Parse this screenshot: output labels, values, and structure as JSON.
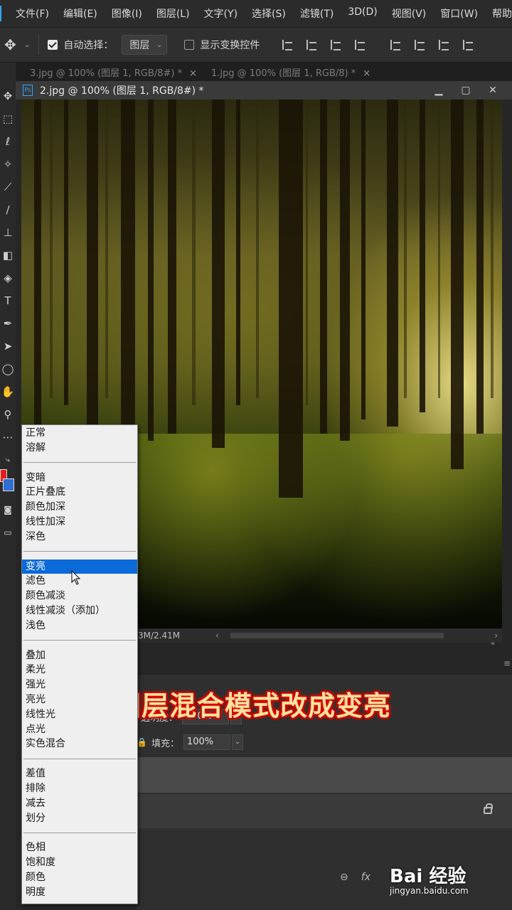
{
  "app": {
    "logo_text": "Ps",
    "menu": [
      "文件(F)",
      "编辑(E)",
      "图像(I)",
      "图层(L)",
      "文字(Y)",
      "选择(S)",
      "滤镜(T)",
      "3D(D)",
      "视图(V)",
      "窗口(W)",
      "帮助"
    ]
  },
  "options_bar": {
    "auto_select_label": "自动选择：",
    "auto_select_checked": true,
    "auto_select_target": "图层",
    "show_transform_label": "显示变换控件",
    "show_transform_checked": false
  },
  "tabs": {
    "inactive": [
      "3.jpg @ 100% (图层 1, RGB/8#) *",
      "1.jpg @ 100% (图层 1, RGB/8) *"
    ],
    "active": "2.jpg @ 100% (图层 1, RGB/8#) *",
    "close_glyph": "×"
  },
  "status": {
    "doc_size": "3M/2.41M"
  },
  "layers_panel": {
    "opacity_label": "透明度：",
    "opacity_value": "100%",
    "fill_label": "填充：",
    "fill_value": "100%"
  },
  "blend_menu": {
    "groups": [
      [
        "正常",
        "溶解"
      ],
      [
        "变暗",
        "正片叠底",
        "颜色加深",
        "线性加深",
        "深色"
      ],
      [
        "变亮",
        "滤色",
        "颜色减淡",
        "线性减淡（添加）",
        "浅色"
      ],
      [
        "叠加",
        "柔光",
        "强光",
        "亮光",
        "线性光",
        "点光",
        "实色混合"
      ],
      [
        "差值",
        "排除",
        "减去",
        "划分"
      ],
      [
        "色相",
        "饱和度",
        "颜色",
        "明度"
      ]
    ],
    "selected": "变亮"
  },
  "caption": "图层混合模式改成变亮",
  "watermark": {
    "logo": "Bai 经验",
    "url": "jingyan.baidu.com"
  },
  "colors": {
    "accent": "#0a6ad8",
    "foreground_swatch": "#e81b1b",
    "background_swatch": "#2f6ed3",
    "caption_glow": "#e00000"
  },
  "icons": {
    "tools": [
      "move-icon",
      "marquee-icon",
      "lasso-icon",
      "magic-wand-icon",
      "eyedropper-icon",
      "brush-icon",
      "stamp-icon",
      "eraser-icon",
      "bucket-icon",
      "type-icon",
      "pen-icon",
      "path-select-icon",
      "shape-icon",
      "hand-icon",
      "zoom-icon",
      "more-icon"
    ]
  }
}
